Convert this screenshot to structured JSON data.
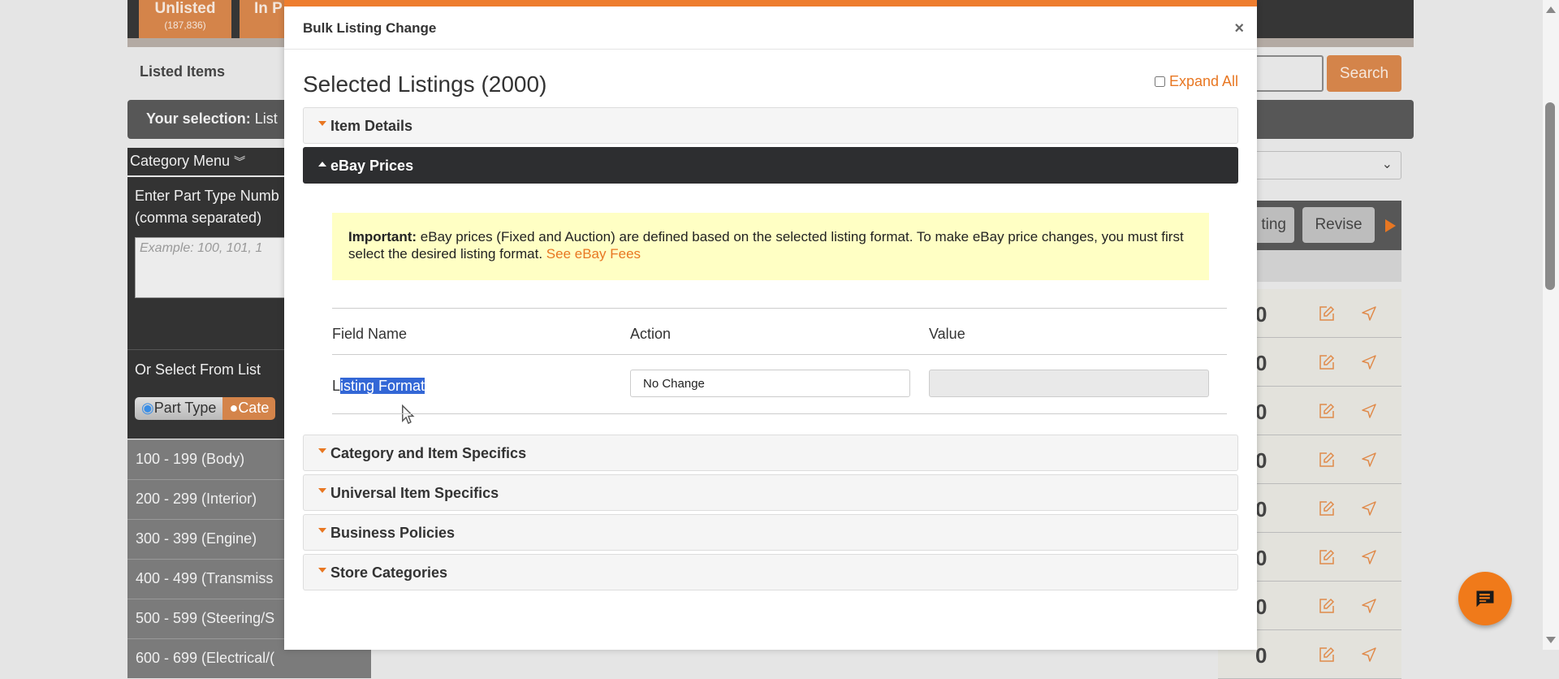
{
  "background": {
    "tabs": [
      {
        "label": "Unlisted",
        "count": "(187,836)"
      },
      {
        "label": "In P"
      }
    ],
    "listed_items": "Listed Items",
    "selection_label": "Your selection:",
    "selection_value": "List",
    "category_menu": "Category Menu",
    "part_type_label_1": "Enter Part Type Numb",
    "part_type_label_2": "(comma separated)",
    "part_type_placeholder": "Example: 100, 101, 1",
    "or_select": "Or Select From List",
    "radio_part_type": "Part Type",
    "radio_category": "Cate",
    "categories": [
      "100 - 199 (Body)",
      "200 - 299 (Interior)",
      "300 - 399 (Engine)",
      "400 - 499 (Transmiss",
      "500 - 599 (Steering/S",
      "600 - 699 (Electrical/("
    ],
    "search_button": "Search",
    "toolbar_buttons": [
      "ting",
      "Revise"
    ],
    "row_values": [
      "0",
      "0",
      "0",
      "0",
      "0",
      "0",
      "0",
      "0"
    ]
  },
  "modal": {
    "title": "Bulk Listing Change",
    "close": "×",
    "selected": "Selected Listings (2000)",
    "expand_all": "Expand All",
    "sections": {
      "item_details": "Item Details",
      "ebay_prices": "eBay Prices",
      "category": "Category and Item Specifics",
      "universal": "Universal Item Specifics",
      "business": "Business Policies",
      "store": "Store Categories"
    },
    "important_label": "Important:",
    "important_text": " eBay prices (Fixed and Auction) are defined based on the selected listing format. To make eBay price changes, you must first select the desired listing format. ",
    "fees_link": "See eBay Fees",
    "table": {
      "headers": [
        "Field Name",
        "Action",
        "Value"
      ],
      "field_first": "L",
      "field_rest": "isting Format",
      "action_value": "No Change",
      "value": ""
    }
  },
  "colors": {
    "accent": "#ee7d2e",
    "dark": "#2d2e30",
    "notice": "#ffffc4"
  }
}
